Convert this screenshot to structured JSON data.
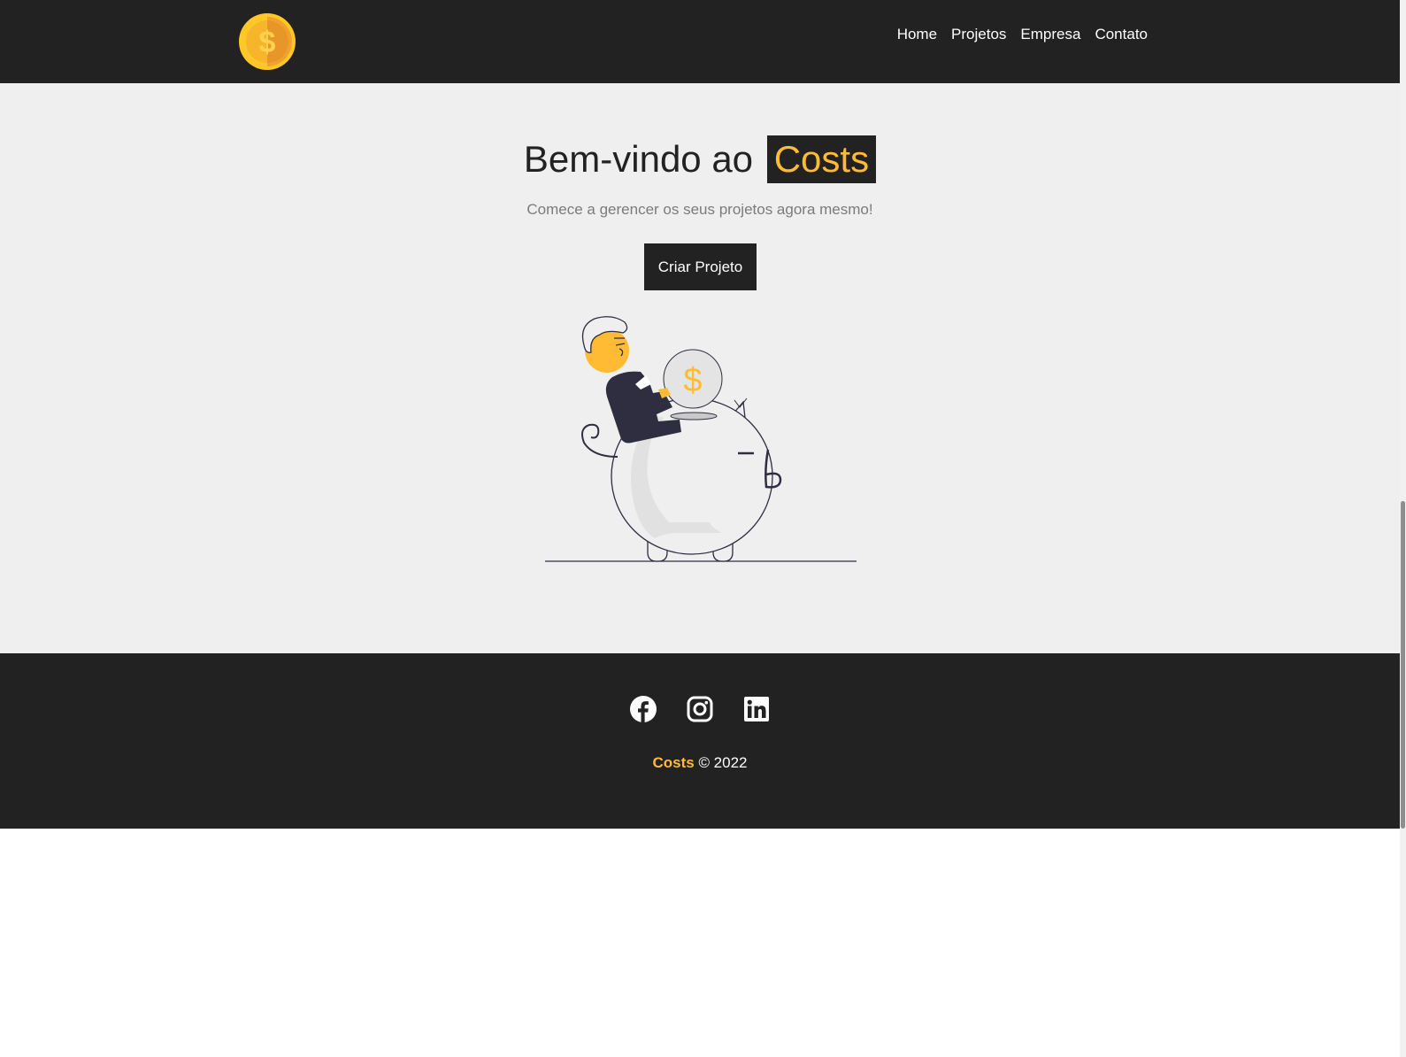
{
  "nav": {
    "logo_icon": "coin-dollar-icon",
    "items": [
      {
        "label": "Home"
      },
      {
        "label": "Projetos"
      },
      {
        "label": "Empresa"
      },
      {
        "label": "Contato"
      }
    ]
  },
  "hero": {
    "title_prefix": "Bem-vindo ao",
    "title_brand": "Costs",
    "subtitle": "Comece a gerencer os seus projetos agora mesmo!",
    "button_label": "Criar Projeto",
    "illustration": "person-saving-coin-in-piggy-bank",
    "coin_symbol": "$"
  },
  "footer": {
    "social": [
      {
        "icon": "facebook-icon"
      },
      {
        "icon": "instagram-icon"
      },
      {
        "icon": "linkedin-icon"
      }
    ],
    "brand": "Costs",
    "copyright": "© 2022"
  },
  "colors": {
    "dark": "#222222",
    "accent": "#ffbb33",
    "background": "#efefef",
    "muted_text": "#7b7b7b"
  }
}
